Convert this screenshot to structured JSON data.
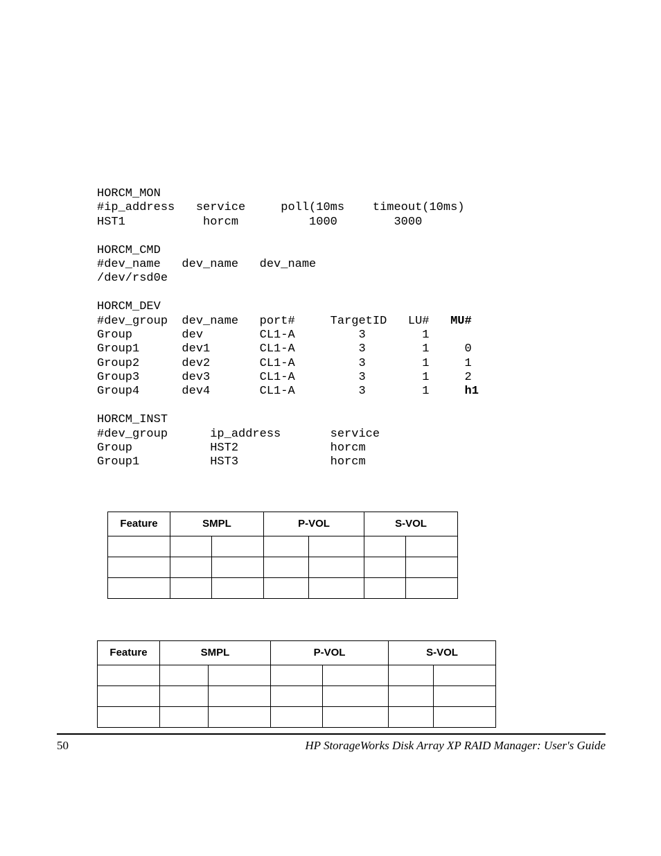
{
  "config": {
    "horcm_mon": {
      "title": "HORCM_MON",
      "header": "#ip_address   service     poll(10ms    timeout(10ms)",
      "row": "HST1           horcm          1000        3000"
    },
    "horcm_cmd": {
      "title": "HORCM_CMD",
      "header": "#dev_name   dev_name   dev_name",
      "row": "/dev/rsd0e"
    },
    "horcm_dev": {
      "title": "HORCM_DEV",
      "header_main": "#dev_group  dev_name   port#     TargetID   LU#   ",
      "header_bold": "MU#",
      "rows": [
        "Group       dev        CL1-A         3        1",
        "Group1      dev1       CL1-A         3        1     0",
        "Group2      dev2       CL1-A         3        1     1",
        "Group3      dev3       CL1-A         3        1     2"
      ],
      "last_row_main": "Group4      dev4       CL1-A         3        1     ",
      "last_row_bold": "h1"
    },
    "horcm_inst": {
      "title": "HORCM_INST",
      "header": "#dev_group      ip_address       service",
      "rows": [
        "Group           HST2             horcm",
        "Group1          HST3             horcm"
      ]
    }
  },
  "tables": {
    "header": {
      "feature": "Feature",
      "smpl": "SMPL",
      "pvol": "P-VOL",
      "svol": "S-VOL"
    }
  },
  "footer": {
    "page": "50",
    "title": "HP StorageWorks Disk Array XP RAID Manager: User's Guide"
  }
}
